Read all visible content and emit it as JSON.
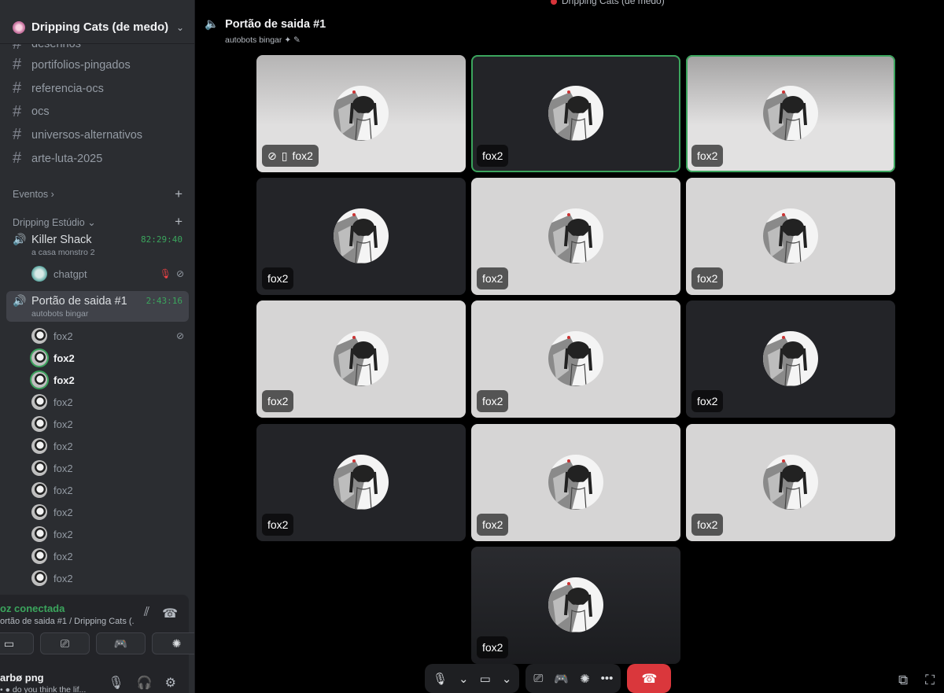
{
  "window_title": "Dripping Cats (de medo)",
  "server": {
    "name": "Dripping Cats (de medo)"
  },
  "text_channels": [
    "desenhos",
    "portifolios-pingados",
    "referencia-ocs",
    "ocs",
    "universos-alternativos",
    "arte-luta-2025"
  ],
  "categories": {
    "events": "Eventos",
    "studio": "Dripping Estúdio"
  },
  "voice_channels": [
    {
      "name": "Killer Shack",
      "time": "82:29:40",
      "status": "a casa monstro 2",
      "users": [
        "chatgpt"
      ]
    },
    {
      "name": "Portão de saida #1",
      "time": "2:43:16",
      "status": "autobots bingar"
    }
  ],
  "members": [
    "fox2",
    "fox2",
    "fox2",
    "fox2",
    "fox2",
    "fox2",
    "fox2",
    "fox2",
    "fox2",
    "fox2",
    "fox2",
    "fox2"
  ],
  "voice_panel": {
    "status": "oz conectada",
    "channel": "ortão de saida #1 / Dripping Cats (..."
  },
  "user_panel": {
    "name": "arbø png",
    "status": "do you think the lif..."
  },
  "main": {
    "title": "Portão de saida #1",
    "status": "autobots bingar"
  },
  "tiles": [
    {
      "label": "fox2",
      "theme": "grad1",
      "muted": true
    },
    {
      "label": "fox2",
      "theme": "dark",
      "speaking": true
    },
    {
      "label": "fox2",
      "theme": "grad2",
      "speaking": true
    },
    {
      "label": "fox2",
      "theme": "dark"
    },
    {
      "label": "fox2",
      "theme": "light"
    },
    {
      "label": "fox2",
      "theme": "light"
    },
    {
      "label": "fox2",
      "theme": "light"
    },
    {
      "label": "fox2",
      "theme": "light"
    },
    {
      "label": "fox2",
      "theme": "dark"
    },
    {
      "label": "fox2",
      "theme": "dark"
    },
    {
      "label": "fox2",
      "theme": "light"
    },
    {
      "label": "fox2",
      "theme": "light"
    },
    {
      "label": "fox2",
      "theme": "grad3"
    }
  ],
  "colors": {
    "accent_green": "#3ba55d",
    "hangup_red": "#da373c",
    "sidebar_bg": "#2b2d31"
  }
}
